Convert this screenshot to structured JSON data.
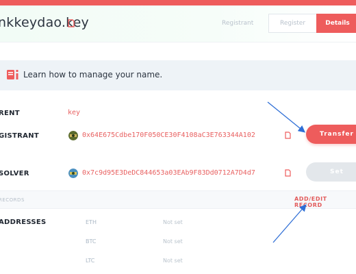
{
  "header": {
    "domain": "nkkeydao.key",
    "tabs": {
      "registrant": "Registrant",
      "register": "Register",
      "details": "Details"
    }
  },
  "learn": {
    "text": "Learn how to manage your name."
  },
  "fields": {
    "parent": {
      "label": "RENT",
      "value": "key"
    },
    "registrant": {
      "label": "GISTRANT",
      "address": "0x64E675Cdbe170F050CE30F4108aC3E763344A102",
      "button": "Transfer"
    },
    "resolver": {
      "label": "SOLVER",
      "address": "0x7c9d95E3DeDC844653a03EAb9F83Dd0712A7D4d7",
      "button": "Set"
    }
  },
  "records": {
    "label": "RECORDS",
    "add_edit": "ADD/EDIT RECORD",
    "addresses_label": "ADDRESSES",
    "coins": [
      {
        "symbol": "ETH",
        "value": "Not set"
      },
      {
        "symbol": "BTC",
        "value": "Not set"
      },
      {
        "symbol": "LTC",
        "value": "Not set"
      }
    ]
  },
  "colors": {
    "accent": "#ee5c5c",
    "annotation_arrow": "#2f6fd6"
  },
  "icons": [
    "copy-icon",
    "book-icon",
    "avatar-icon",
    "arrow-annotation"
  ]
}
